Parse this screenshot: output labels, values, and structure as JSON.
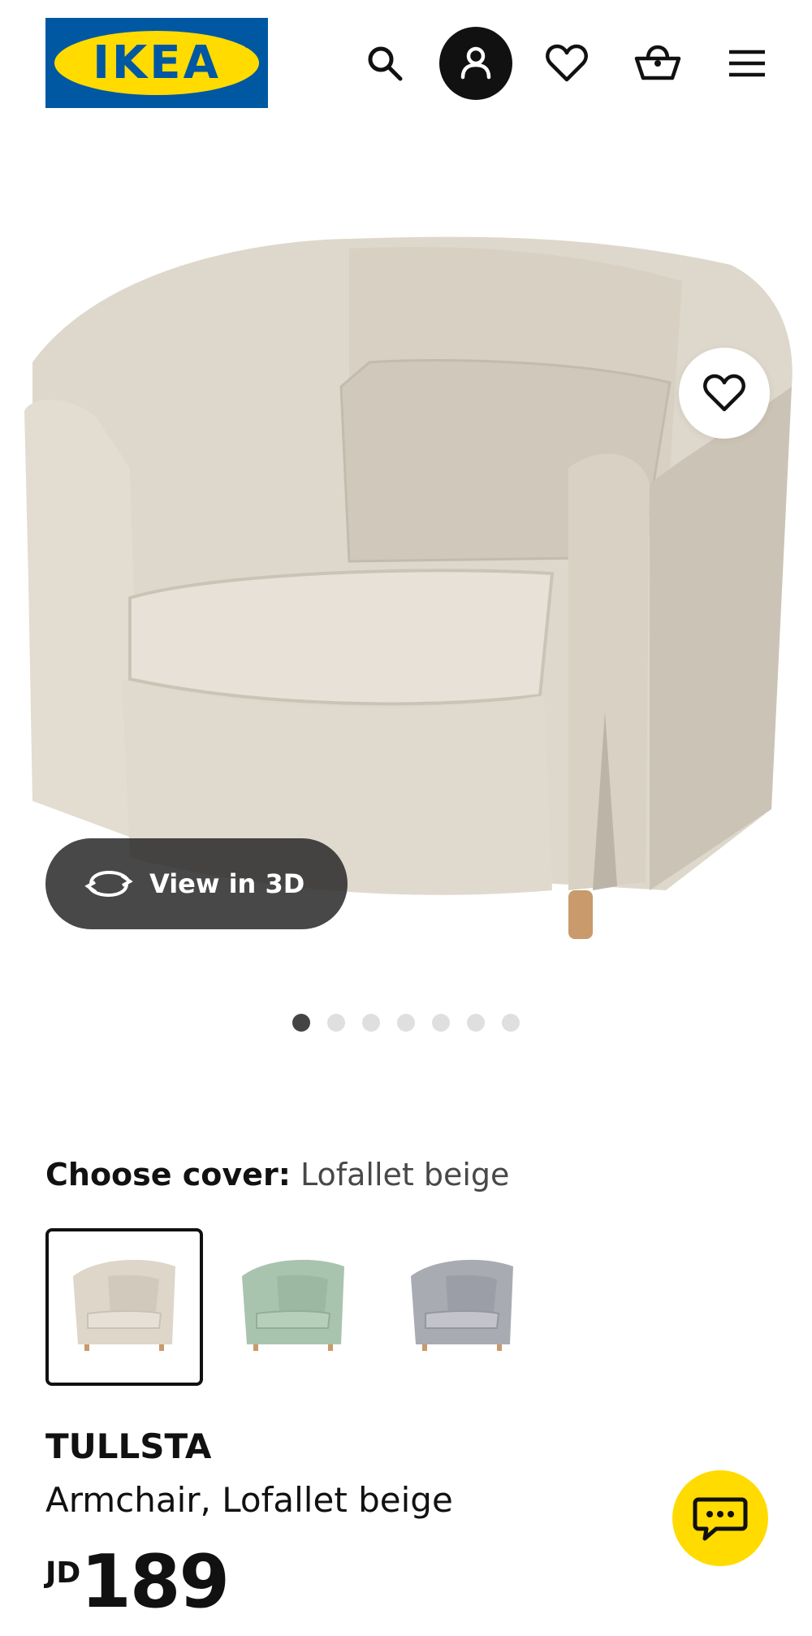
{
  "header": {
    "logo_text": "IKEA",
    "logo_registered": "®",
    "icons": [
      "search-icon",
      "account-icon",
      "heart-icon",
      "basket-icon",
      "menu-icon"
    ]
  },
  "gallery": {
    "view3d_label": "View in 3D",
    "dots": [
      true,
      false,
      false,
      false,
      false,
      false,
      false
    ]
  },
  "cover": {
    "label": "Choose cover:",
    "value": "Lofallet beige",
    "swatches": [
      {
        "color": "#ddd6c9",
        "selected": true
      },
      {
        "color": "#a9c4ae",
        "selected": false
      },
      {
        "color": "#a9abb3",
        "selected": false
      }
    ]
  },
  "product": {
    "name": "TULLSTA",
    "description": "Armchair, Lofallet beige",
    "currency": "JD",
    "price": "189"
  },
  "colors": {
    "brand_blue": "#0058a3",
    "brand_yellow": "#ffdb00"
  }
}
